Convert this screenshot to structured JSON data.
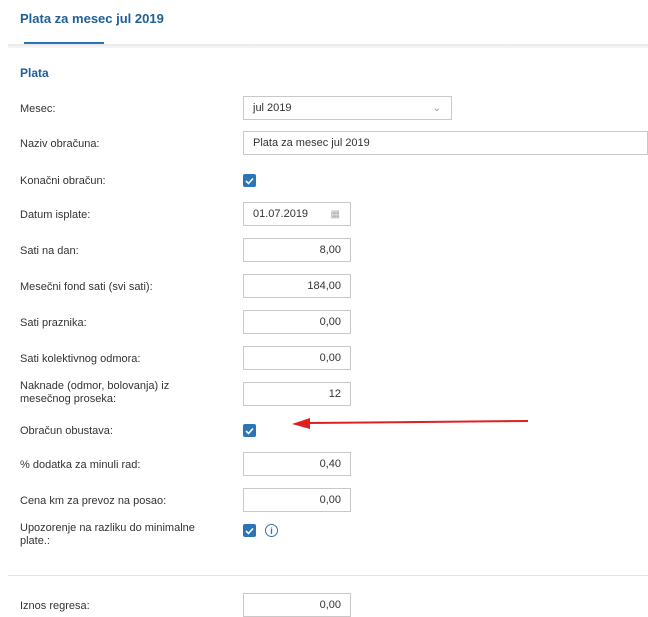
{
  "header": {
    "title": "Plata za mesec jul 2019"
  },
  "section": {
    "title": "Plata"
  },
  "form": {
    "mesec": {
      "label": "Mesec:",
      "value": "jul 2019"
    },
    "naziv": {
      "label": "Naziv obračuna:",
      "value": "Plata za mesec jul 2019"
    },
    "konacni": {
      "label": "Konačni obračun:",
      "checked": true
    },
    "datum": {
      "label": "Datum isplate:",
      "value": "01.07.2019"
    },
    "sati_dan": {
      "label": "Sati na dan:",
      "value": "8,00"
    },
    "fond": {
      "label": "Mesečni fond sati (svi sati):",
      "value": "184,00"
    },
    "praznik": {
      "label": "Sati praznika:",
      "value": "0,00"
    },
    "kolektivni": {
      "label": "Sati kolektivnog odmora:",
      "value": "0,00"
    },
    "naknade": {
      "label_line1": "Naknade (odmor, bolovanja) iz",
      "label_line2": "mesečnog proseka:",
      "value": "12"
    },
    "obustava": {
      "label": "Obračun obustava:",
      "checked": true
    },
    "minuli": {
      "label": "% dodatka za minuli rad:",
      "value": "0,40"
    },
    "prevoz": {
      "label": "Cena km za prevoz na posao:",
      "value": "0,00"
    },
    "upozorenje": {
      "label_line1": "Upozorenje na razliku do minimalne",
      "label_line2": "plate.:",
      "checked": true
    },
    "regres": {
      "label": "Iznos regresa:",
      "value": "0,00"
    }
  },
  "colors": {
    "accent": "#2a74b7",
    "title": "#1e5f97",
    "arrow": "#e02020"
  }
}
